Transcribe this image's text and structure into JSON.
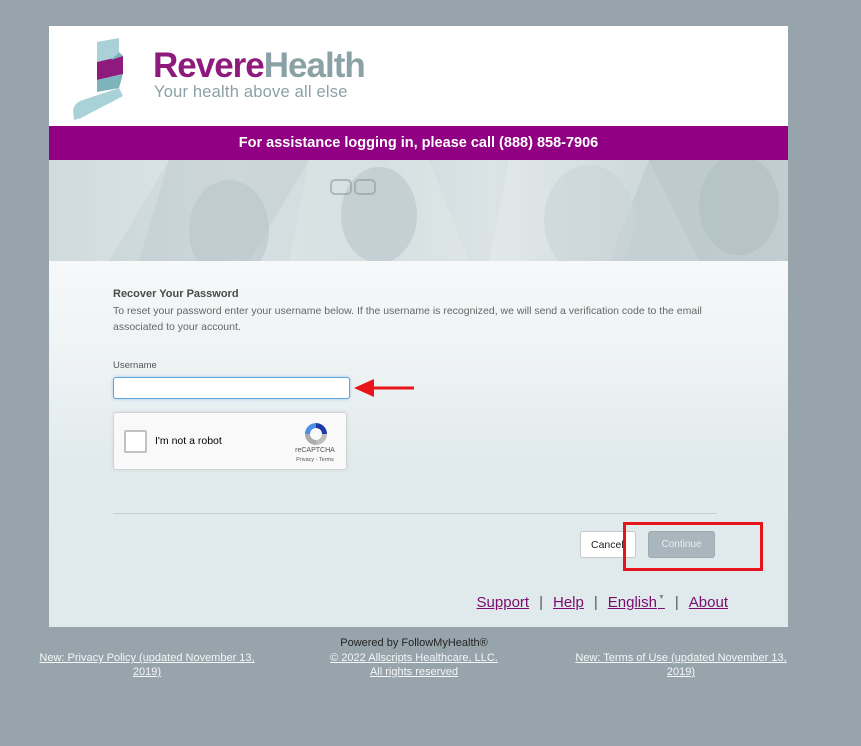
{
  "brand": {
    "name_part1": "Revere",
    "name_part2": "Health",
    "tagline": "Your health above all else",
    "colors": {
      "primary": "#910083",
      "secondary": "#8aa1a6",
      "accent_teal": "#a8d2d8"
    }
  },
  "banner": {
    "text": "For assistance logging in, please call (888) 858-7906"
  },
  "form": {
    "title": "Recover Your Password",
    "description": "To reset your password enter your username below. If the username is recognized, we will send a verification code to the email associated to your account.",
    "username_label": "Username",
    "username_value": "",
    "username_placeholder": "",
    "captcha": {
      "label": "I'm not a robot",
      "brand": "reCAPTCHA",
      "links": "Privacy - Terms",
      "checked": false
    },
    "cancel_label": "Cancel",
    "continue_label": "Continue"
  },
  "footer_links": {
    "support": "Support",
    "help": "Help",
    "language": "English",
    "about": "About",
    "separator": "|"
  },
  "bottom": {
    "privacy": "New: Privacy Policy (updated November 13, 2019)",
    "powered_by": "Powered by FollowMyHealth®",
    "copyright": "© 2022 Allscripts Healthcare, LLC.",
    "rights": "All rights reserved",
    "terms": "New: Terms of Use (updated November 13, 2019)"
  },
  "annotations": {
    "arrow_color": "#e8141b",
    "box_color": "#e8141b"
  }
}
